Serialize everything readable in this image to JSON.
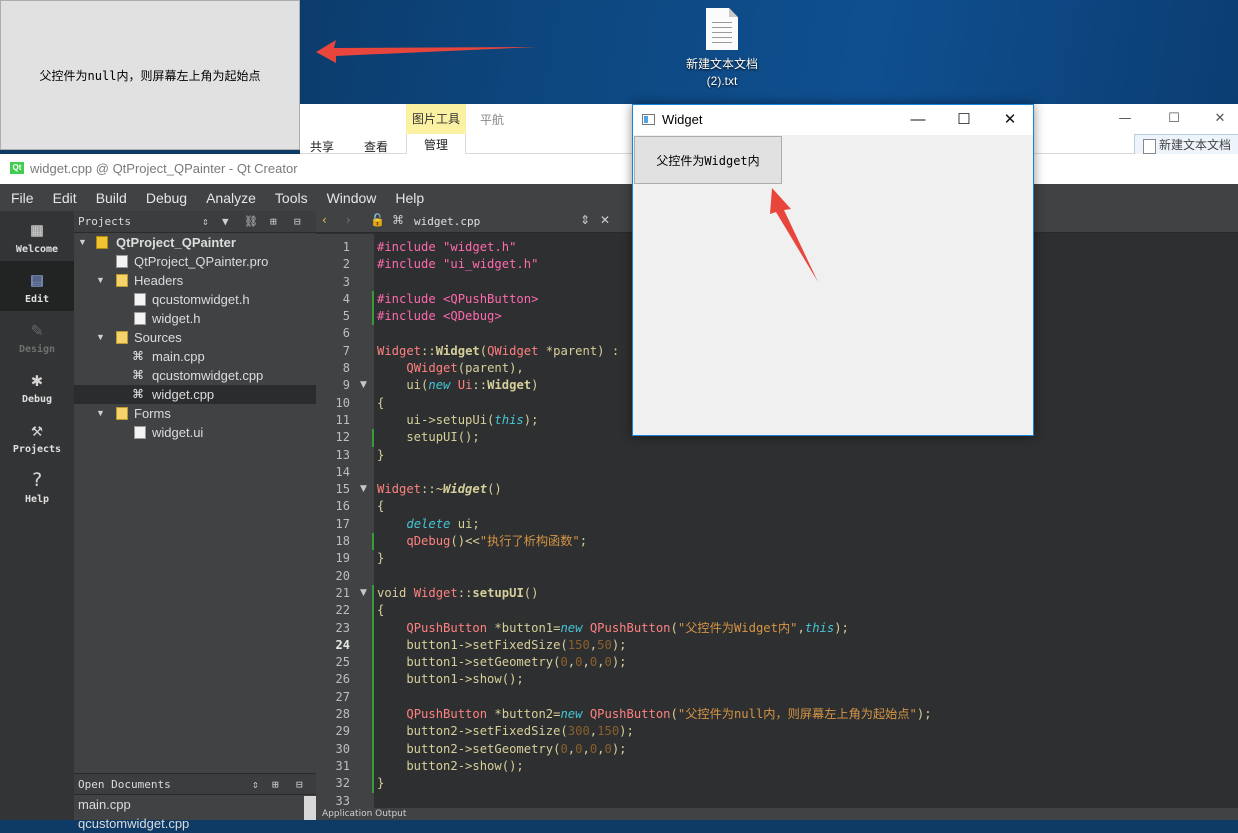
{
  "desktop": {
    "file_name_line1": "新建文本文档",
    "file_name_line2": "(2).txt"
  },
  "null_parent_window": {
    "button_text": "父控件为null内，则屏幕左上角为起始点"
  },
  "explorer": {
    "tab_share": "共享",
    "tab_view": "查看",
    "picture_tools": "图片工具",
    "tab_manage": "管理",
    "tab_nav": "平航",
    "tab_title": "新建文本文档"
  },
  "qt": {
    "window_title": "widget.cpp @ QtProject_QPainter - Qt Creator",
    "menu": [
      "File",
      "Edit",
      "Build",
      "Debug",
      "Analyze",
      "Tools",
      "Window",
      "Help"
    ],
    "modes": [
      "Welcome",
      "Edit",
      "Design",
      "Debug",
      "Projects",
      "Help"
    ],
    "projects_label": "Projects",
    "tree": [
      {
        "label": "QtProject_QPainter",
        "bold": true
      },
      {
        "label": "QtProject_QPainter.pro"
      },
      {
        "label": "Headers"
      },
      {
        "label": "qcustomwidget.h"
      },
      {
        "label": "widget.h"
      },
      {
        "label": "Sources"
      },
      {
        "label": "main.cpp"
      },
      {
        "label": "qcustomwidget.cpp"
      },
      {
        "label": "widget.cpp"
      },
      {
        "label": "Forms"
      },
      {
        "label": "widget.ui"
      }
    ],
    "open_documents_label": "Open Documents",
    "open_documents": [
      "main.cpp",
      "qcustomwidget.cpp"
    ],
    "editor_file": "widget.cpp",
    "bottom_label": "Application Output",
    "code": [
      "#include \"widget.h\"",
      "#include \"ui_widget.h\"",
      "",
      "#include <QPushButton>",
      "#include <QDebug>",
      "",
      "Widget::Widget(QWidget *parent) :",
      "    QWidget(parent),",
      "    ui(new Ui::Widget)",
      "{",
      "    ui->setupUi(this);",
      "    setupUI();",
      "}",
      "",
      "Widget::~Widget()",
      "{",
      "    delete ui;",
      "    qDebug()<<\"执行了析构函数\";",
      "}",
      "",
      "void Widget::setupUI()",
      "{",
      "    QPushButton *button1=new QPushButton(\"父控件为Widget内\",this);",
      "    button1->setFixedSize(150,50);",
      "    button1->setGeometry(0,0,0,0);",
      "    button1->show();",
      "",
      "    QPushButton *button2=new QPushButton(\"父控件为null内，则屏幕左上角为起始点\");",
      "    button2->setFixedSize(300,150);",
      "    button2->setGeometry(0,0,0,0);",
      "    button2->show();",
      "}",
      ""
    ]
  },
  "widget_window": {
    "title": "Widget",
    "button_text": "父控件为Widget内"
  },
  "colors": {
    "arrow": "#e8453c",
    "qt_dark": "#2e2f30",
    "widget_border": "#1883d7"
  }
}
